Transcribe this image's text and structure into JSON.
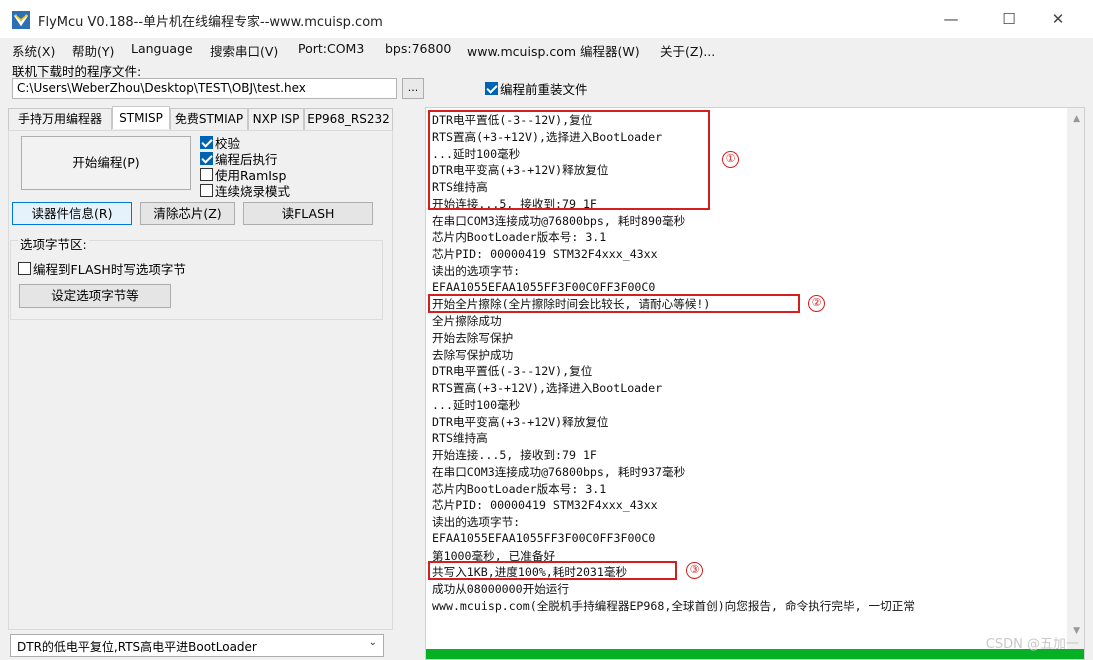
{
  "window": {
    "title": "FlyMcu V0.188--单片机在线编程专家--www.mcuisp.com",
    "controls": {
      "minimize": "—",
      "maximize": "☐",
      "close": "✕"
    }
  },
  "menu": [
    "系统(X)",
    "帮助(Y)",
    "Language",
    "搜索串口(V)",
    "Port:COM3",
    "bps:76800",
    "www.mcuisp.com 编程器(W)",
    "关于(Z)..."
  ],
  "file": {
    "label": "联机下载时的程序文件:",
    "path": "C:\\Users\\WeberZhou\\Desktop\\TEST\\OBJ\\test.hex",
    "browse_label": "...",
    "reload_label": "编程前重装文件",
    "reload_checked": true
  },
  "tabs": [
    "手持万用编程器",
    "STMISP",
    "免费STMIAP",
    "NXP ISP",
    "EP968_RS232"
  ],
  "stmisp": {
    "start_button": "开始编程(P)",
    "checks": [
      {
        "label": "校验",
        "checked": true
      },
      {
        "label": "编程后执行",
        "checked": true
      },
      {
        "label": "使用RamIsp",
        "checked": false
      },
      {
        "label": "连续烧录模式",
        "checked": false
      }
    ],
    "read_info_button": "读器件信息(R)",
    "clear_button": "清除芯片(Z)",
    "read_flash_button": "读FLASH",
    "option_group_title": "选项字节区:",
    "option_check_label": "编程到FLASH时写选项字节",
    "option_check_checked": false,
    "set_option_button": "设定选项字节等"
  },
  "bottom_select": {
    "value": "DTR的低电平复位,RTS高电平进BootLoader",
    "arrow": "⌄"
  },
  "log": {
    "lines": [
      "DTR电平置低(-3--12V),复位",
      "RTS置高(+3-+12V),选择进入BootLoader",
      "...延时100毫秒",
      "DTR电平变高(+3-+12V)释放复位",
      "RTS维持高",
      "开始连接...5, 接收到:79 1F",
      "在串口COM3连接成功@76800bps, 耗时890毫秒",
      "芯片内BootLoader版本号: 3.1",
      "芯片PID: 00000419  STM32F4xxx_43xx",
      "读出的选项字节:",
      "EFAA1055EFAA1055FF3F00C0FF3F00C0",
      "开始全片擦除(全片擦除时间会比较长, 请耐心等候!)",
      "全片擦除成功",
      "开始去除写保护",
      "去除写保护成功",
      "DTR电平置低(-3--12V),复位",
      "RTS置高(+3-+12V),选择进入BootLoader",
      "...延时100毫秒",
      "DTR电平变高(+3-+12V)释放复位",
      "RTS维持高",
      "开始连接...5, 接收到:79 1F",
      "在串口COM3连接成功@76800bps, 耗时937毫秒",
      "芯片内BootLoader版本号: 3.1",
      "芯片PID: 00000419  STM32F4xxx_43xx",
      "读出的选项字节:",
      "EFAA1055EFAA1055FF3F00C0FF3F00C0",
      "第1000毫秒, 已准备好",
      "共写入1KB,进度100%,耗时2031毫秒",
      "成功从08000000开始运行",
      "www.mcuisp.com(全脱机手持编程器EP968,全球首创)向您报告, 命令执行完毕, 一切正常"
    ],
    "markers": [
      "①",
      "②",
      "③"
    ],
    "progress_fraction": 1.0
  },
  "watermark": "CSDN @五加一",
  "colors": {
    "highlight": "#d51f1f",
    "progress": "#06b025",
    "accent": "#0078d7"
  }
}
